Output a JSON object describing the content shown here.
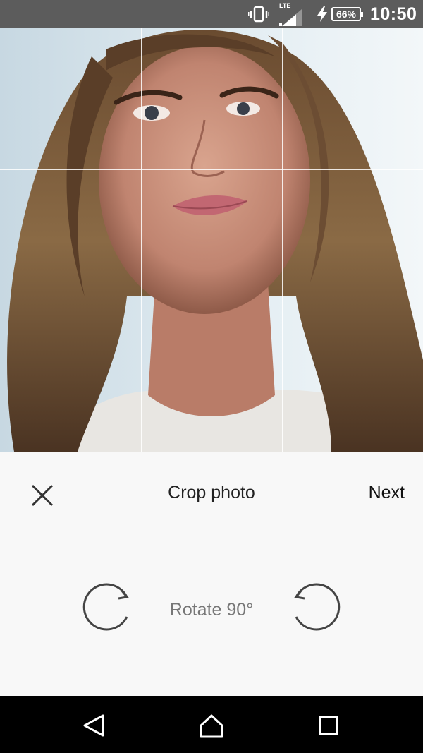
{
  "status_bar": {
    "network_type": "LTE",
    "battery_percent": "66%",
    "time": "10:50",
    "icons": [
      "vibrate-icon",
      "signal-icon",
      "charging-icon",
      "battery-icon"
    ]
  },
  "toolbar": {
    "title": "Crop photo",
    "next_label": "Next",
    "close_icon": "close-icon"
  },
  "rotate": {
    "label": "Rotate 90°",
    "left_icon": "rotate-clockwise-icon",
    "right_icon": "rotate-counterclockwise-icon"
  },
  "nav_bar": {
    "icons": [
      "back-icon",
      "home-icon",
      "recents-icon"
    ]
  },
  "colors": {
    "status_bar_bg": "#5c5c5c",
    "toolbar_bg": "#f8f8f8",
    "nav_bar_bg": "#000000",
    "grid_line": "#ffffff"
  }
}
